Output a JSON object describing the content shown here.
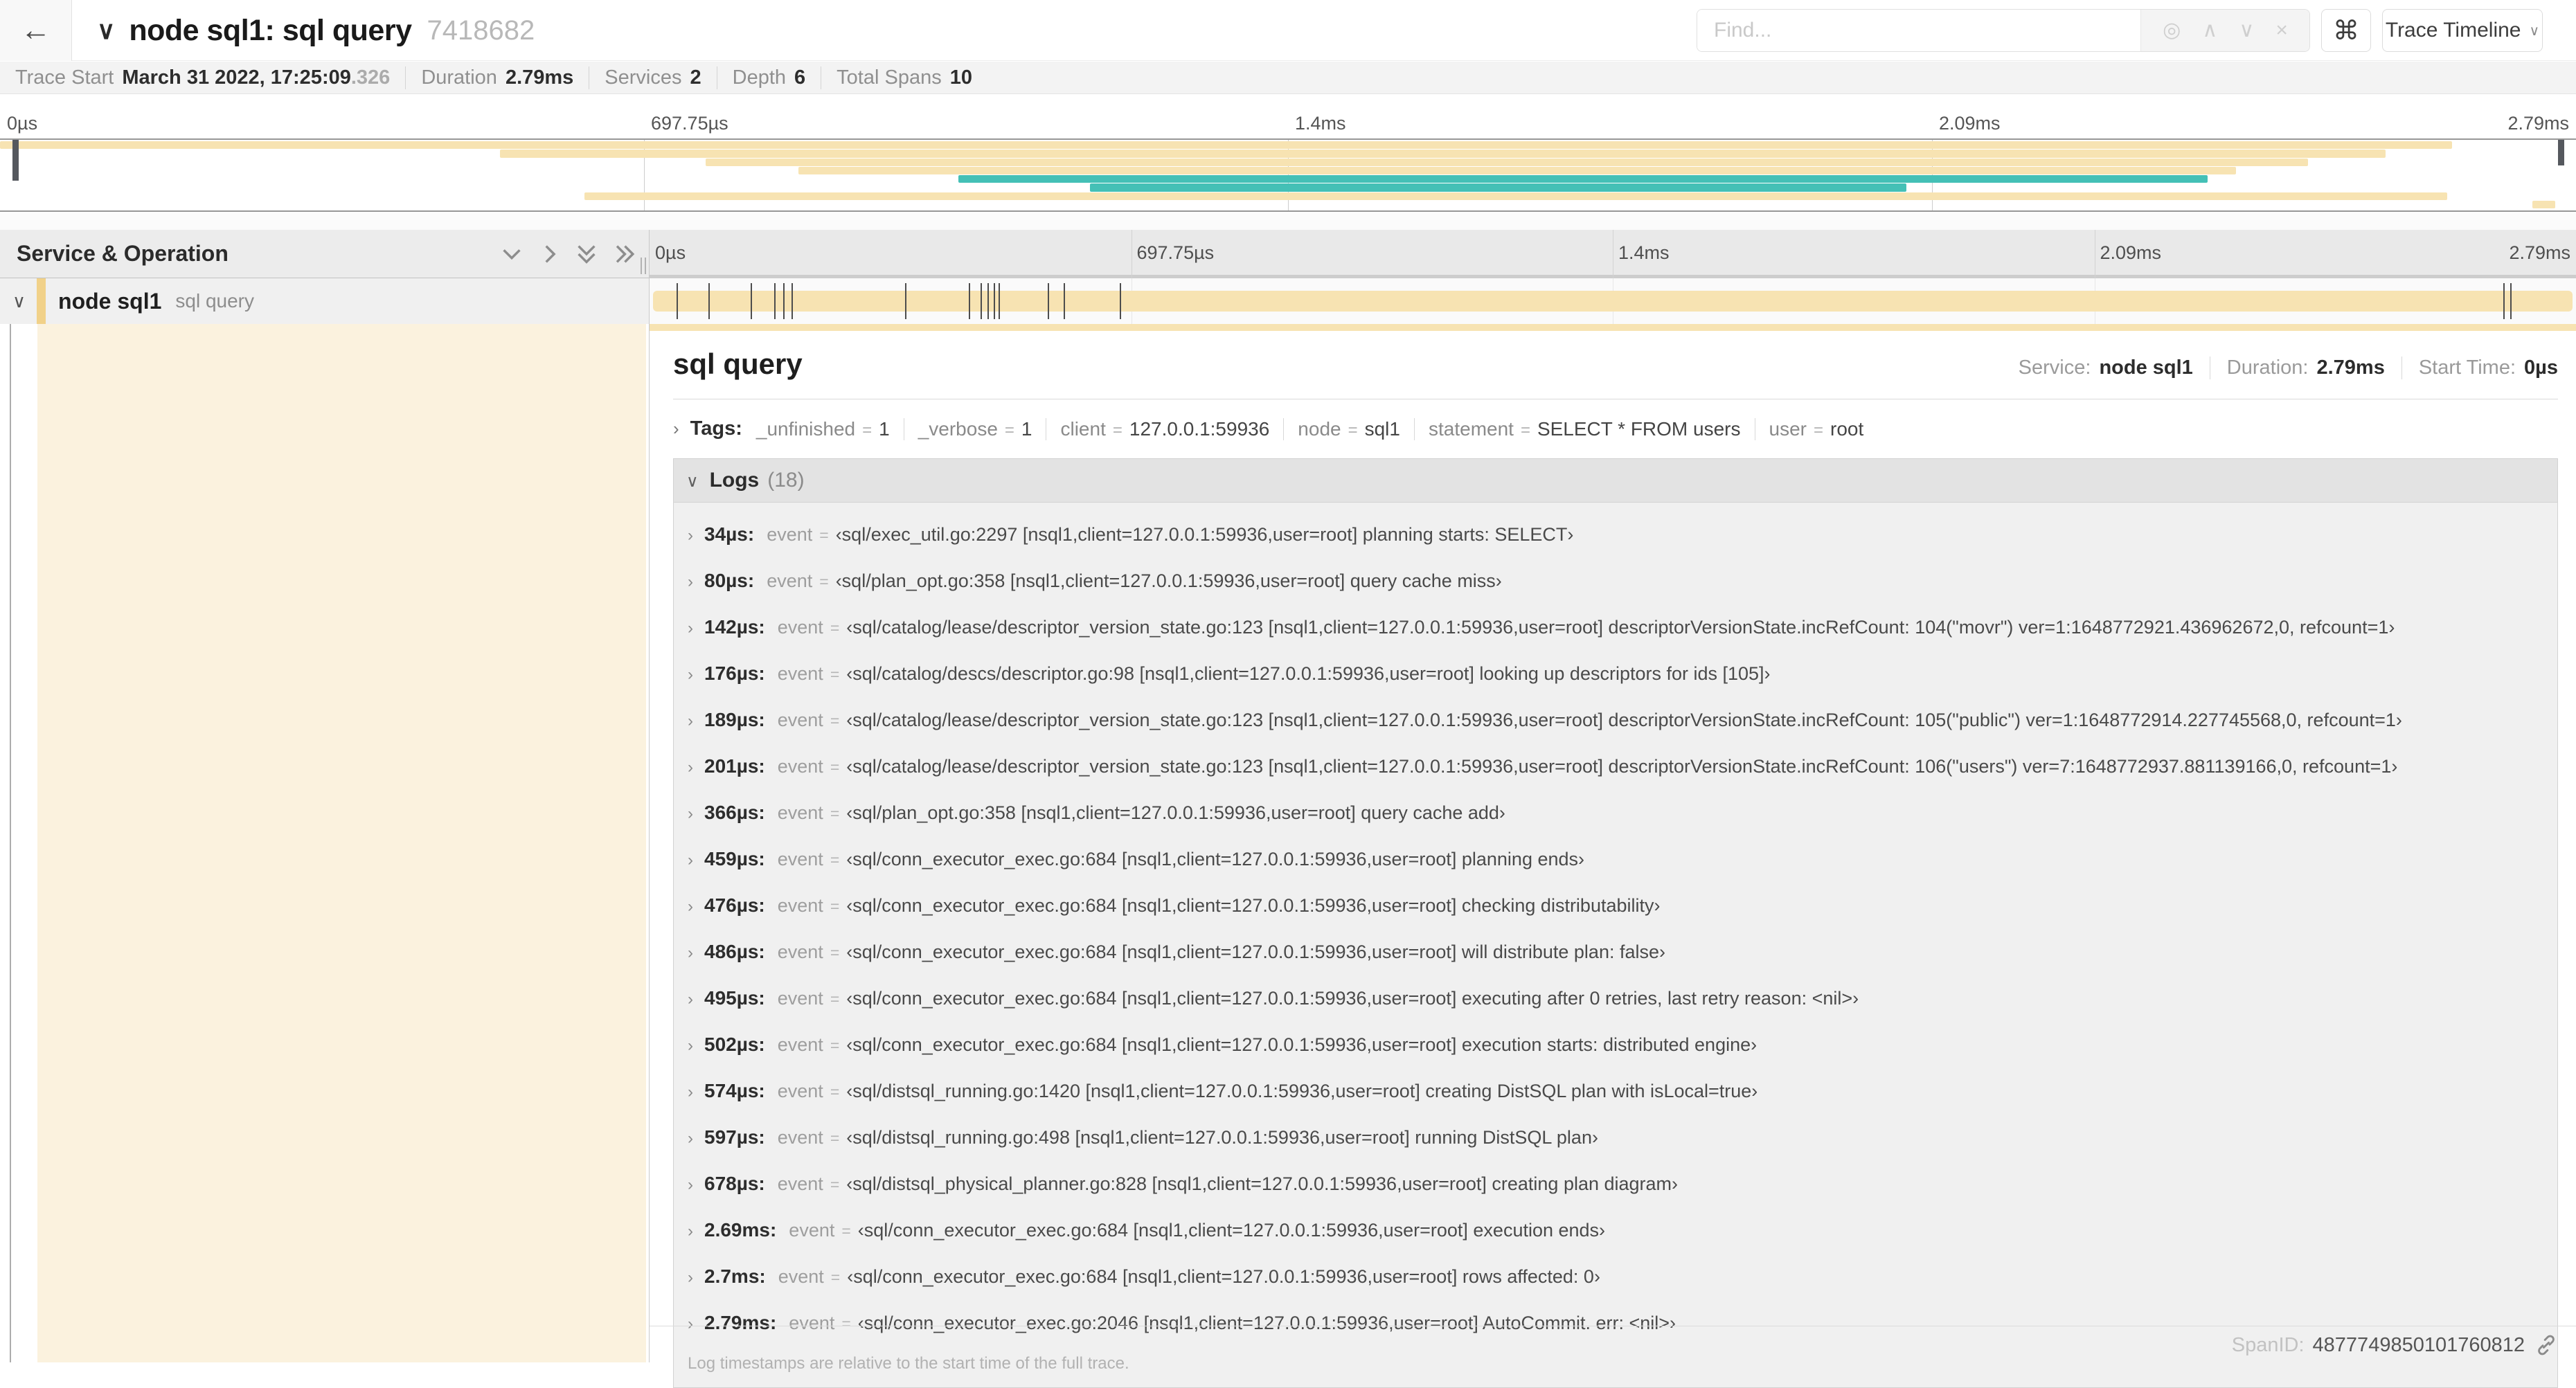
{
  "icons": {
    "back": "←",
    "chevron_down": "∨",
    "chevron_right": "›",
    "chevron_up": "∧",
    "target": "◎",
    "close": "×",
    "command": "⌘"
  },
  "colors": {
    "tan": "#f7e3b2",
    "teal": "#44c0b6",
    "accent": "#f1d189",
    "cream": "#fbf2de"
  },
  "header": {
    "title": "node sql1: sql query",
    "trace_id": "7418682",
    "find_placeholder": "Find...",
    "view_dropdown": "Trace Timeline"
  },
  "summary": {
    "trace_start_label": "Trace Start",
    "trace_start": "March 31 2022, 17:25:09",
    "trace_start_frac": ".326",
    "duration_label": "Duration",
    "duration": "2.79ms",
    "services_label": "Services",
    "services": "2",
    "depth_label": "Depth",
    "depth": "6",
    "total_spans_label": "Total Spans",
    "total_spans": "10"
  },
  "ruler": {
    "ticks": [
      "0µs",
      "697.75µs",
      "1.4ms",
      "2.09ms",
      "2.79ms"
    ]
  },
  "minimap": {
    "bars": [
      {
        "row": 0,
        "left": 0,
        "width": 95.2,
        "color": "tan"
      },
      {
        "row": 1,
        "left": 19.4,
        "width": 73.2,
        "color": "tan"
      },
      {
        "row": 2,
        "left": 27.4,
        "width": 62.2,
        "color": "tan"
      },
      {
        "row": 3,
        "left": 31.0,
        "width": 55.8,
        "color": "tan"
      },
      {
        "row": 4,
        "left": 37.2,
        "width": 48.5,
        "color": "teal"
      },
      {
        "row": 5,
        "left": 42.3,
        "width": 31.7,
        "color": "teal"
      },
      {
        "row": 6,
        "left": 22.7,
        "width": 72.3,
        "color": "tan"
      },
      {
        "row": 7,
        "left": 98.3,
        "width": 0.9,
        "color": "tan"
      }
    ]
  },
  "columns": {
    "service_header": "Service & Operation"
  },
  "span_row": {
    "service": "node sql1",
    "operation": "sql query",
    "tick_percents": [
      1.22,
      2.87,
      5.09,
      6.31,
      6.77,
      7.2,
      13.12,
      16.45,
      17.06,
      17.42,
      17.74,
      17.99,
      20.57,
      21.4,
      24.3,
      96.4,
      96.77
    ]
  },
  "detail": {
    "title": "sql query",
    "service_label": "Service:",
    "service": "node sql1",
    "duration_label": "Duration:",
    "duration": "2.79ms",
    "start_label": "Start Time:",
    "start": "0µs",
    "tags": {
      "label": "Tags:",
      "items": [
        {
          "k": "_unfinished",
          "v": "1"
        },
        {
          "k": "_verbose",
          "v": "1"
        },
        {
          "k": "client",
          "v": "127.0.0.1:59936"
        },
        {
          "k": "node",
          "v": "sql1"
        },
        {
          "k": "statement",
          "v": "SELECT * FROM users"
        },
        {
          "k": "user",
          "v": "root"
        }
      ]
    },
    "logs": {
      "label": "Logs",
      "count": "(18)",
      "key_label": "event",
      "eq": "=",
      "rows": [
        {
          "t": "34µs:",
          "v": "‹sql/exec_util.go:2297 [nsql1,client=127.0.0.1:59936,user=root] planning starts: SELECT›"
        },
        {
          "t": "80µs:",
          "v": "‹sql/plan_opt.go:358 [nsql1,client=127.0.0.1:59936,user=root] query cache miss›"
        },
        {
          "t": "142µs:",
          "v": "‹sql/catalog/lease/descriptor_version_state.go:123 [nsql1,client=127.0.0.1:59936,user=root] descriptorVersionState.incRefCount: 104(\"movr\") ver=1:1648772921.436962672,0, refcount=1›"
        },
        {
          "t": "176µs:",
          "v": "‹sql/catalog/descs/descriptor.go:98 [nsql1,client=127.0.0.1:59936,user=root] looking up descriptors for ids [105]›"
        },
        {
          "t": "189µs:",
          "v": "‹sql/catalog/lease/descriptor_version_state.go:123 [nsql1,client=127.0.0.1:59936,user=root] descriptorVersionState.incRefCount: 105(\"public\") ver=1:1648772914.227745568,0, refcount=1›"
        },
        {
          "t": "201µs:",
          "v": "‹sql/catalog/lease/descriptor_version_state.go:123 [nsql1,client=127.0.0.1:59936,user=root] descriptorVersionState.incRefCount: 106(\"users\") ver=7:1648772937.881139166,0, refcount=1›"
        },
        {
          "t": "366µs:",
          "v": "‹sql/plan_opt.go:358 [nsql1,client=127.0.0.1:59936,user=root] query cache add›"
        },
        {
          "t": "459µs:",
          "v": "‹sql/conn_executor_exec.go:684 [nsql1,client=127.0.0.1:59936,user=root] planning ends›"
        },
        {
          "t": "476µs:",
          "v": "‹sql/conn_executor_exec.go:684 [nsql1,client=127.0.0.1:59936,user=root] checking distributability›"
        },
        {
          "t": "486µs:",
          "v": "‹sql/conn_executor_exec.go:684 [nsql1,client=127.0.0.1:59936,user=root] will distribute plan: false›"
        },
        {
          "t": "495µs:",
          "v": "‹sql/conn_executor_exec.go:684 [nsql1,client=127.0.0.1:59936,user=root] executing after 0 retries, last retry reason: <nil>›"
        },
        {
          "t": "502µs:",
          "v": "‹sql/conn_executor_exec.go:684 [nsql1,client=127.0.0.1:59936,user=root] execution starts: distributed engine›"
        },
        {
          "t": "574µs:",
          "v": "‹sql/distsql_running.go:1420 [nsql1,client=127.0.0.1:59936,user=root] creating DistSQL plan with isLocal=true›"
        },
        {
          "t": "597µs:",
          "v": "‹sql/distsql_running.go:498 [nsql1,client=127.0.0.1:59936,user=root] running DistSQL plan›"
        },
        {
          "t": "678µs:",
          "v": "‹sql/distsql_physical_planner.go:828 [nsql1,client=127.0.0.1:59936,user=root] creating plan diagram›"
        },
        {
          "t": "2.69ms:",
          "v": "‹sql/conn_executor_exec.go:684 [nsql1,client=127.0.0.1:59936,user=root] execution ends›"
        },
        {
          "t": "2.7ms:",
          "v": "‹sql/conn_executor_exec.go:684 [nsql1,client=127.0.0.1:59936,user=root] rows affected: 0›"
        },
        {
          "t": "2.79ms:",
          "v": "‹sql/conn_executor_exec.go:2046 [nsql1,client=127.0.0.1:59936,user=root] AutoCommit. err: <nil>›"
        }
      ]
    },
    "footer": "Log timestamps are relative to the start time of the full trace.",
    "span_id_label": "SpanID:",
    "span_id": "4877749850101760812"
  }
}
